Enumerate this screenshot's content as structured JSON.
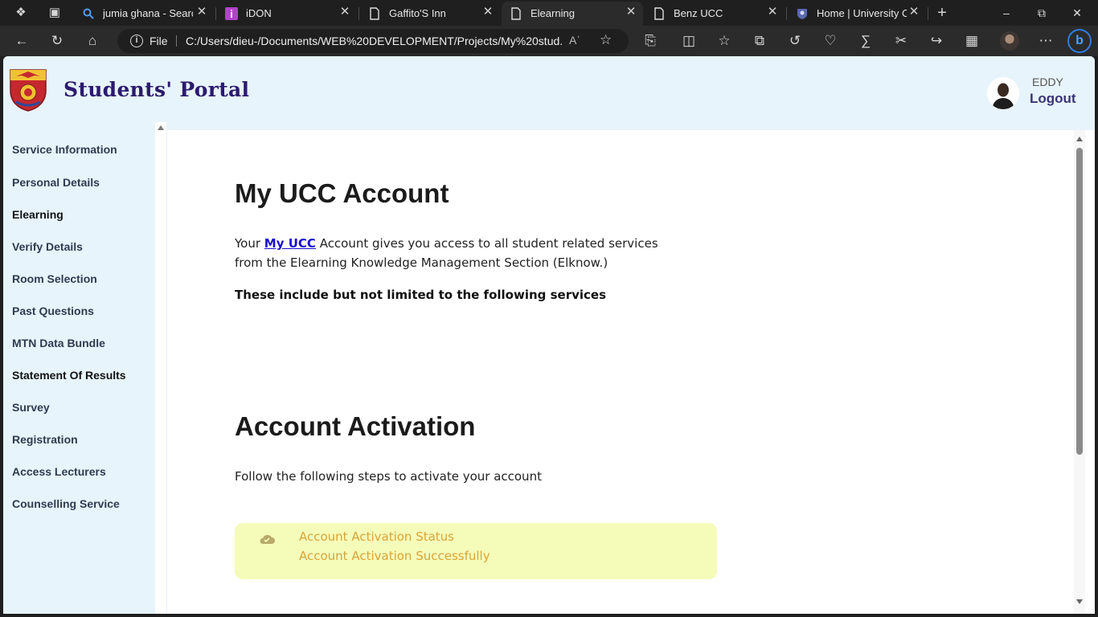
{
  "browser": {
    "tabs": [
      {
        "title": "jumia ghana - Search",
        "icon": "search-icon",
        "active": false
      },
      {
        "title": "iDON",
        "icon": "idon-favicon",
        "active": false
      },
      {
        "title": "Gaffito'S Inn",
        "icon": "page-icon",
        "active": false
      },
      {
        "title": "Elearning",
        "icon": "page-icon",
        "active": true
      },
      {
        "title": "Benz UCC",
        "icon": "page-icon",
        "active": false
      },
      {
        "title": "Home | University Of",
        "icon": "university-crest-icon",
        "active": false
      }
    ],
    "address": {
      "scheme_label": "File",
      "url": "C:/Users/dieu-/Documents/WEB%20DEVELOPMENT/Projects/My%20stud..."
    }
  },
  "header": {
    "title": "Students' Portal",
    "user_name": "EDDY",
    "logout_label": "Logout"
  },
  "sidebar": {
    "items": [
      {
        "label": "Service Information"
      },
      {
        "label": "Personal Details"
      },
      {
        "label": "Elearning"
      },
      {
        "label": "Verify Details"
      },
      {
        "label": "Room Selection"
      },
      {
        "label": "Past Questions"
      },
      {
        "label": "MTN Data Bundle"
      },
      {
        "label": "Statement Of Results"
      },
      {
        "label": "Survey"
      },
      {
        "label": "Registration"
      },
      {
        "label": "Access Lecturers"
      },
      {
        "label": "Counselling Service"
      }
    ]
  },
  "main": {
    "account_heading": "My UCC Account",
    "intro_before": "Your ",
    "intro_link": "My UCC",
    "intro_after": " Account gives you access to all student related services from the Elearning Knowledge Management Section (Elknow.)",
    "services_line": "These include but not limited to the following services",
    "activation_heading": "Account Activation",
    "activation_intro": "Follow the following steps to activate your account",
    "status_title": "Account Activation Status",
    "status_message": "Account Activation Successfully"
  },
  "colors": {
    "page_bg": "#e8f4fc",
    "title": "#2b1a6e",
    "link": "#1a0dcc",
    "status_bg": "#f5fcb9",
    "status_text": "#d8a43a"
  }
}
